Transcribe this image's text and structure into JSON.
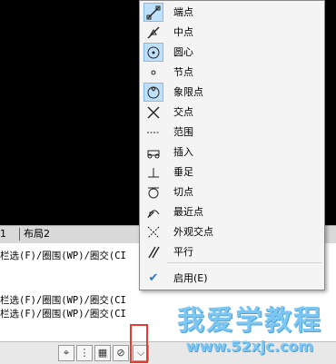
{
  "layout_tabs": {
    "tab1": "1",
    "tab2": "布局2"
  },
  "command_lines": [
    "栏选(F)/圈围(WP)/圈交(CI",
    "栏选(F)/圈围(WP)/圈交(CI",
    "栏选(F)/圈围(WP)/圈交(CI"
  ],
  "command_input_placeholder": "",
  "osnap_menu": {
    "items": [
      {
        "label": "端点",
        "icon": "endpoint-icon",
        "checked": true
      },
      {
        "label": "中点",
        "icon": "midpoint-icon",
        "checked": false
      },
      {
        "label": "圆心",
        "icon": "center-icon",
        "checked": true
      },
      {
        "label": "节点",
        "icon": "node-icon",
        "checked": false
      },
      {
        "label": "象限点",
        "icon": "quadrant-icon",
        "checked": true
      },
      {
        "label": "交点",
        "icon": "intersection-icon",
        "checked": false
      },
      {
        "label": "范围",
        "icon": "extension-icon",
        "checked": false
      },
      {
        "label": "插入",
        "icon": "insert-icon",
        "checked": false
      },
      {
        "label": "垂足",
        "icon": "perpendicular-icon",
        "checked": false
      },
      {
        "label": "切点",
        "icon": "tangent-icon",
        "checked": false
      },
      {
        "label": "最近点",
        "icon": "nearest-icon",
        "checked": false
      },
      {
        "label": "外观交点",
        "icon": "apparent-intersection-icon",
        "checked": false
      },
      {
        "label": "平行",
        "icon": "parallel-icon",
        "checked": false
      }
    ],
    "enable_label": "启用(E)",
    "enable_checked": true
  },
  "watermark": {
    "title": "我爱学教程",
    "url": "www.52xjc.com"
  },
  "colors": {
    "highlight_border": "#e43d2f",
    "menu_check": "#2a74c9",
    "watermark": "#7dc6f2"
  }
}
